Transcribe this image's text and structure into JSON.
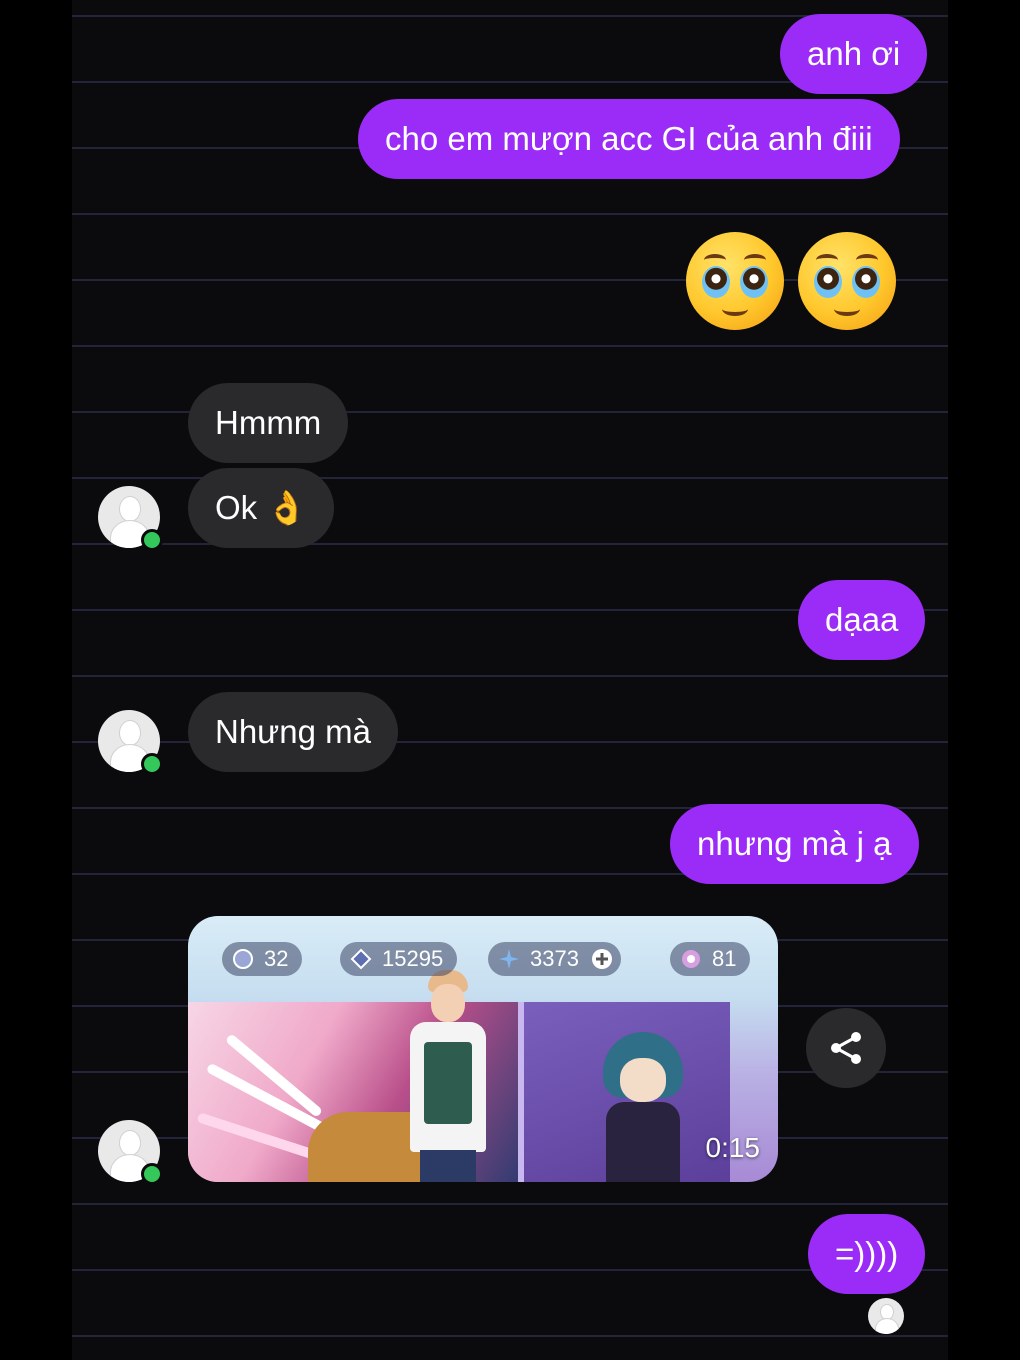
{
  "messages": {
    "m1": "anh ơi",
    "m2": "cho em mượn acc GI của anh điii",
    "m3": "🥹🥹",
    "m4": "Hmmm",
    "m5": "Ok 👌",
    "m6": "dạaa",
    "m7": "Nhưng mà",
    "m8": "nhưng mà j ạ",
    "m9": "=))))"
  },
  "video": {
    "stats": [
      "32",
      "15295",
      "3373",
      "81"
    ],
    "duration": "0:15"
  },
  "icons": {
    "share": "share-icon",
    "avatar": "default-avatar",
    "online": "online-dot"
  },
  "colors": {
    "outgoing_bubble": "#9b2cf7",
    "incoming_bubble": "#2a2a2c",
    "online": "#34c759"
  }
}
